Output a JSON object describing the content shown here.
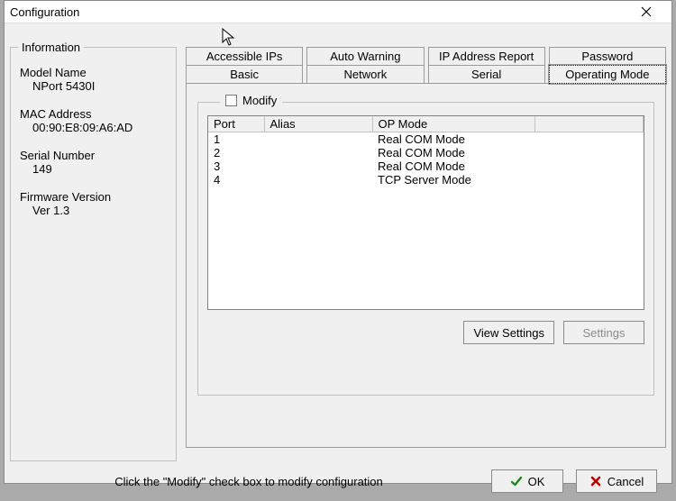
{
  "window": {
    "title": "Configuration"
  },
  "info_group": {
    "legend": "Information",
    "model_label": "Model Name",
    "model_value": "NPort 5430I",
    "mac_label": "MAC Address",
    "mac_value": "00:90:E8:09:A6:AD",
    "serial_label": "Serial Number",
    "serial_value": "149",
    "fw_label": "Firmware Version",
    "fw_value": "Ver 1.3"
  },
  "tabs": {
    "row1": [
      "Accessible IPs",
      "Auto Warning",
      "IP Address Report",
      "Password"
    ],
    "row2": [
      "Basic",
      "Network",
      "Serial",
      "Operating Mode"
    ],
    "active": "Operating Mode"
  },
  "modify": {
    "label": "Modify",
    "checked": false
  },
  "table": {
    "columns": [
      "Port",
      "Alias",
      "OP Mode"
    ],
    "rows": [
      {
        "port": "1",
        "alias": "",
        "opmode": "Real COM Mode"
      },
      {
        "port": "2",
        "alias": "",
        "opmode": "Real COM Mode"
      },
      {
        "port": "3",
        "alias": "",
        "opmode": "Real COM Mode"
      },
      {
        "port": "4",
        "alias": "",
        "opmode": "TCP Server Mode"
      }
    ]
  },
  "buttons": {
    "view_settings": "View Settings",
    "settings": "Settings",
    "ok": "OK",
    "cancel": "Cancel"
  },
  "hint": "Click the \"Modify\" check box to modify configuration"
}
